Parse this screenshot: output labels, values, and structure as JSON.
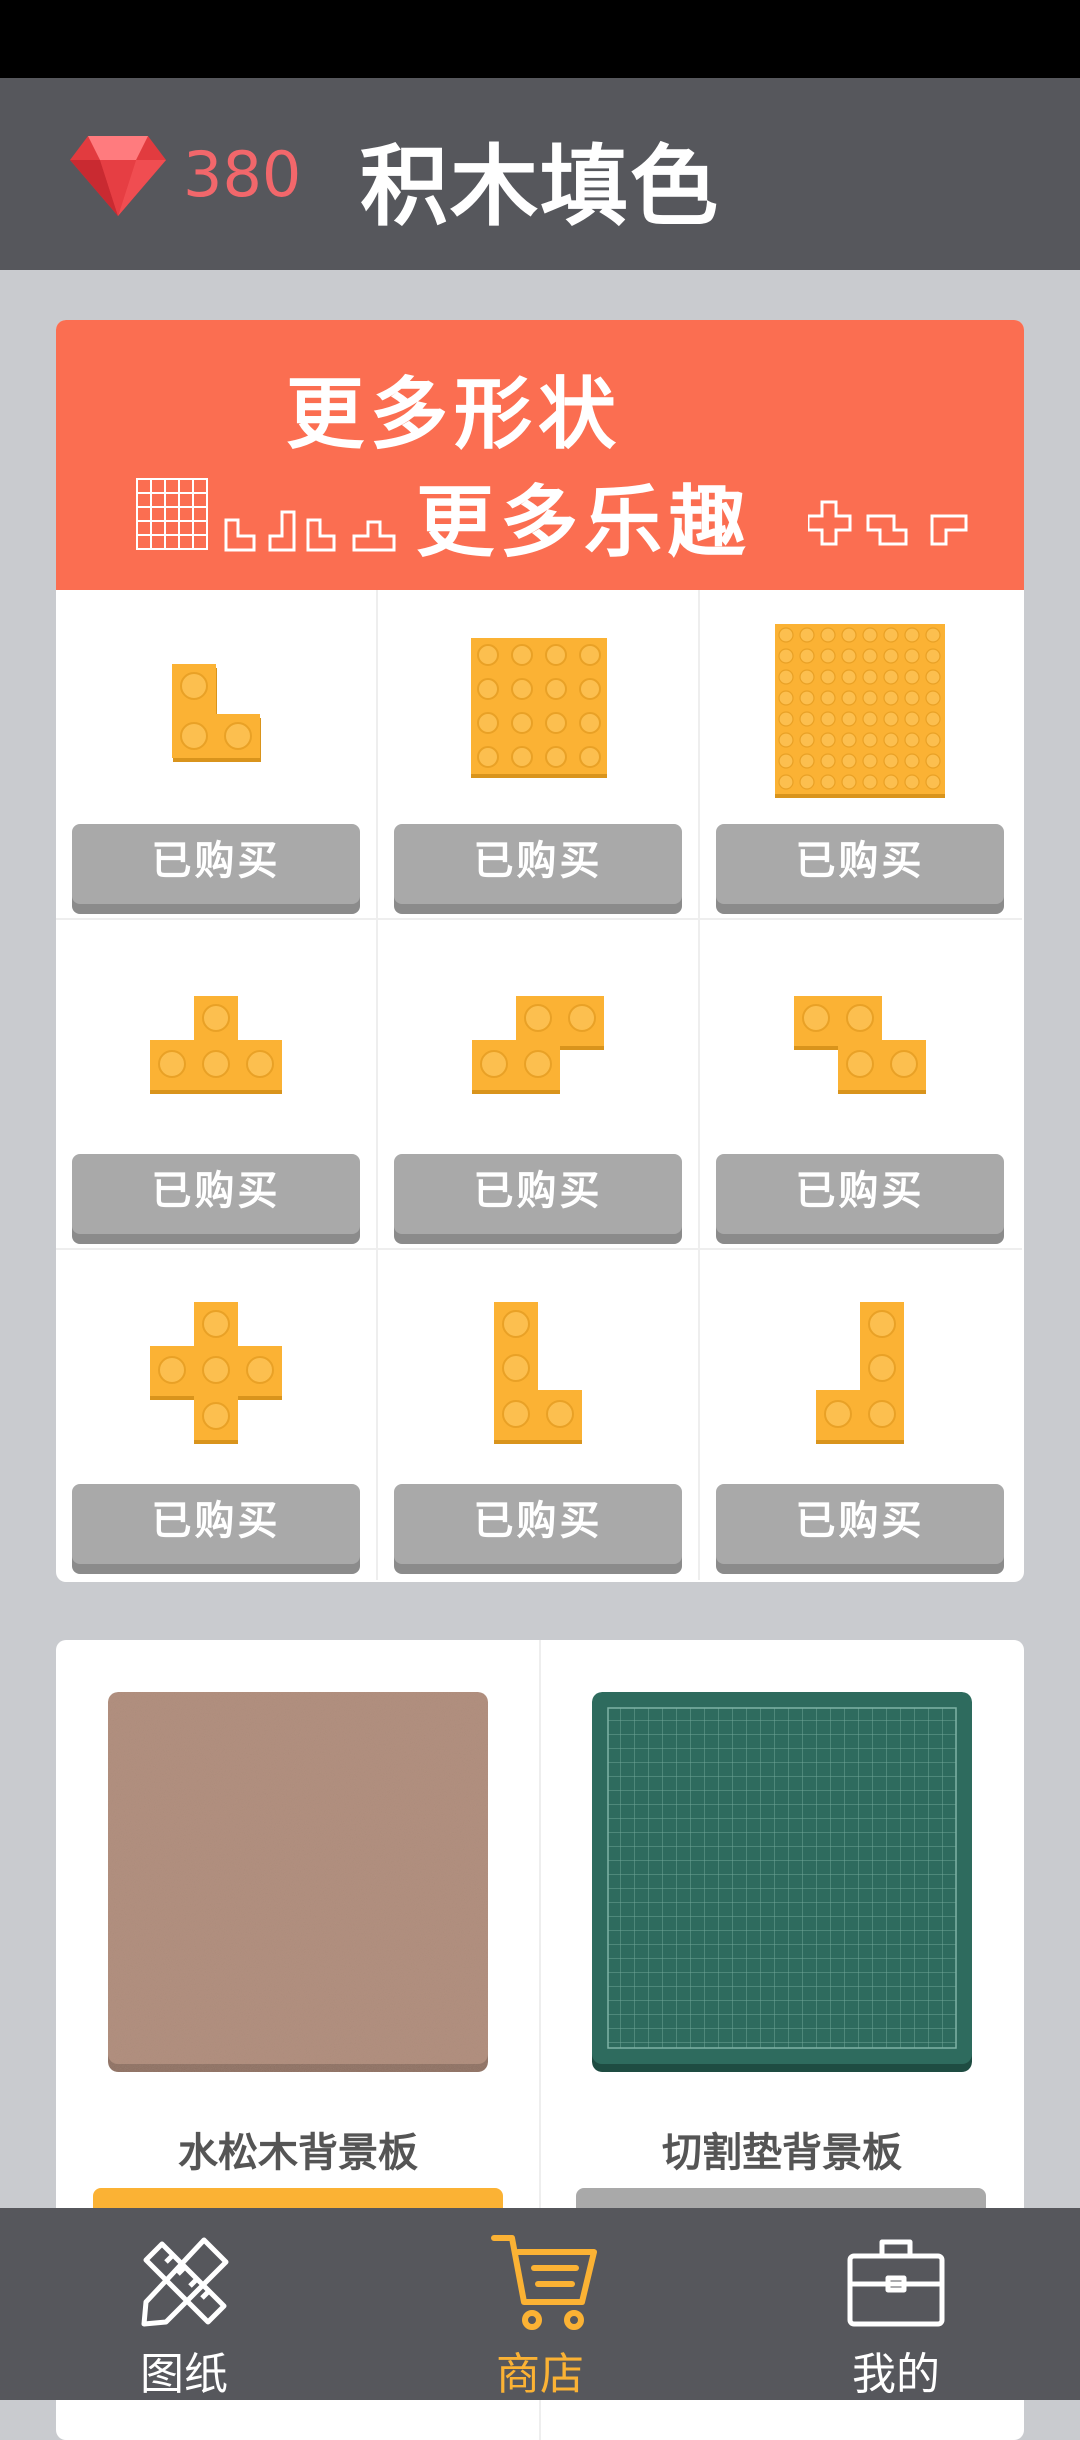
{
  "header": {
    "gem_count": "380",
    "title": "积木填色",
    "gem_icon": "ruby-gem-icon"
  },
  "shop": {
    "banner": {
      "line1": "更多形状",
      "line2": "更多乐趣"
    },
    "items": [
      {
        "shape": "small-l",
        "button_label": "已购买"
      },
      {
        "shape": "square-4x4",
        "button_label": "已购买"
      },
      {
        "shape": "square-8x8",
        "button_label": "已购买"
      },
      {
        "shape": "t-shape",
        "button_label": "已购买"
      },
      {
        "shape": "s-shape",
        "button_label": "已购买"
      },
      {
        "shape": "z-shape",
        "button_label": "已购买"
      },
      {
        "shape": "plus-shape",
        "button_label": "已购买"
      },
      {
        "shape": "l-shape",
        "button_label": "已购买"
      },
      {
        "shape": "j-shape",
        "button_label": "已购买"
      }
    ],
    "colors": {
      "banner": "#fb6e51",
      "brick": "#fbb234",
      "purchased_button": "#a9a9a9"
    }
  },
  "backgrounds": {
    "items": [
      {
        "name": "水松木背景板",
        "color": "#b39180"
      },
      {
        "name": "切割垫背景板",
        "color": "#2e6b5e"
      }
    ]
  },
  "nav": {
    "items": [
      {
        "label": "图纸",
        "icon": "pencil-ruler-icon",
        "active": false
      },
      {
        "label": "商店",
        "icon": "shopping-cart-icon",
        "active": true
      },
      {
        "label": "我的",
        "icon": "briefcase-icon",
        "active": false
      }
    ],
    "active_color": "#fbb234",
    "inactive_color": "#ffffff"
  }
}
